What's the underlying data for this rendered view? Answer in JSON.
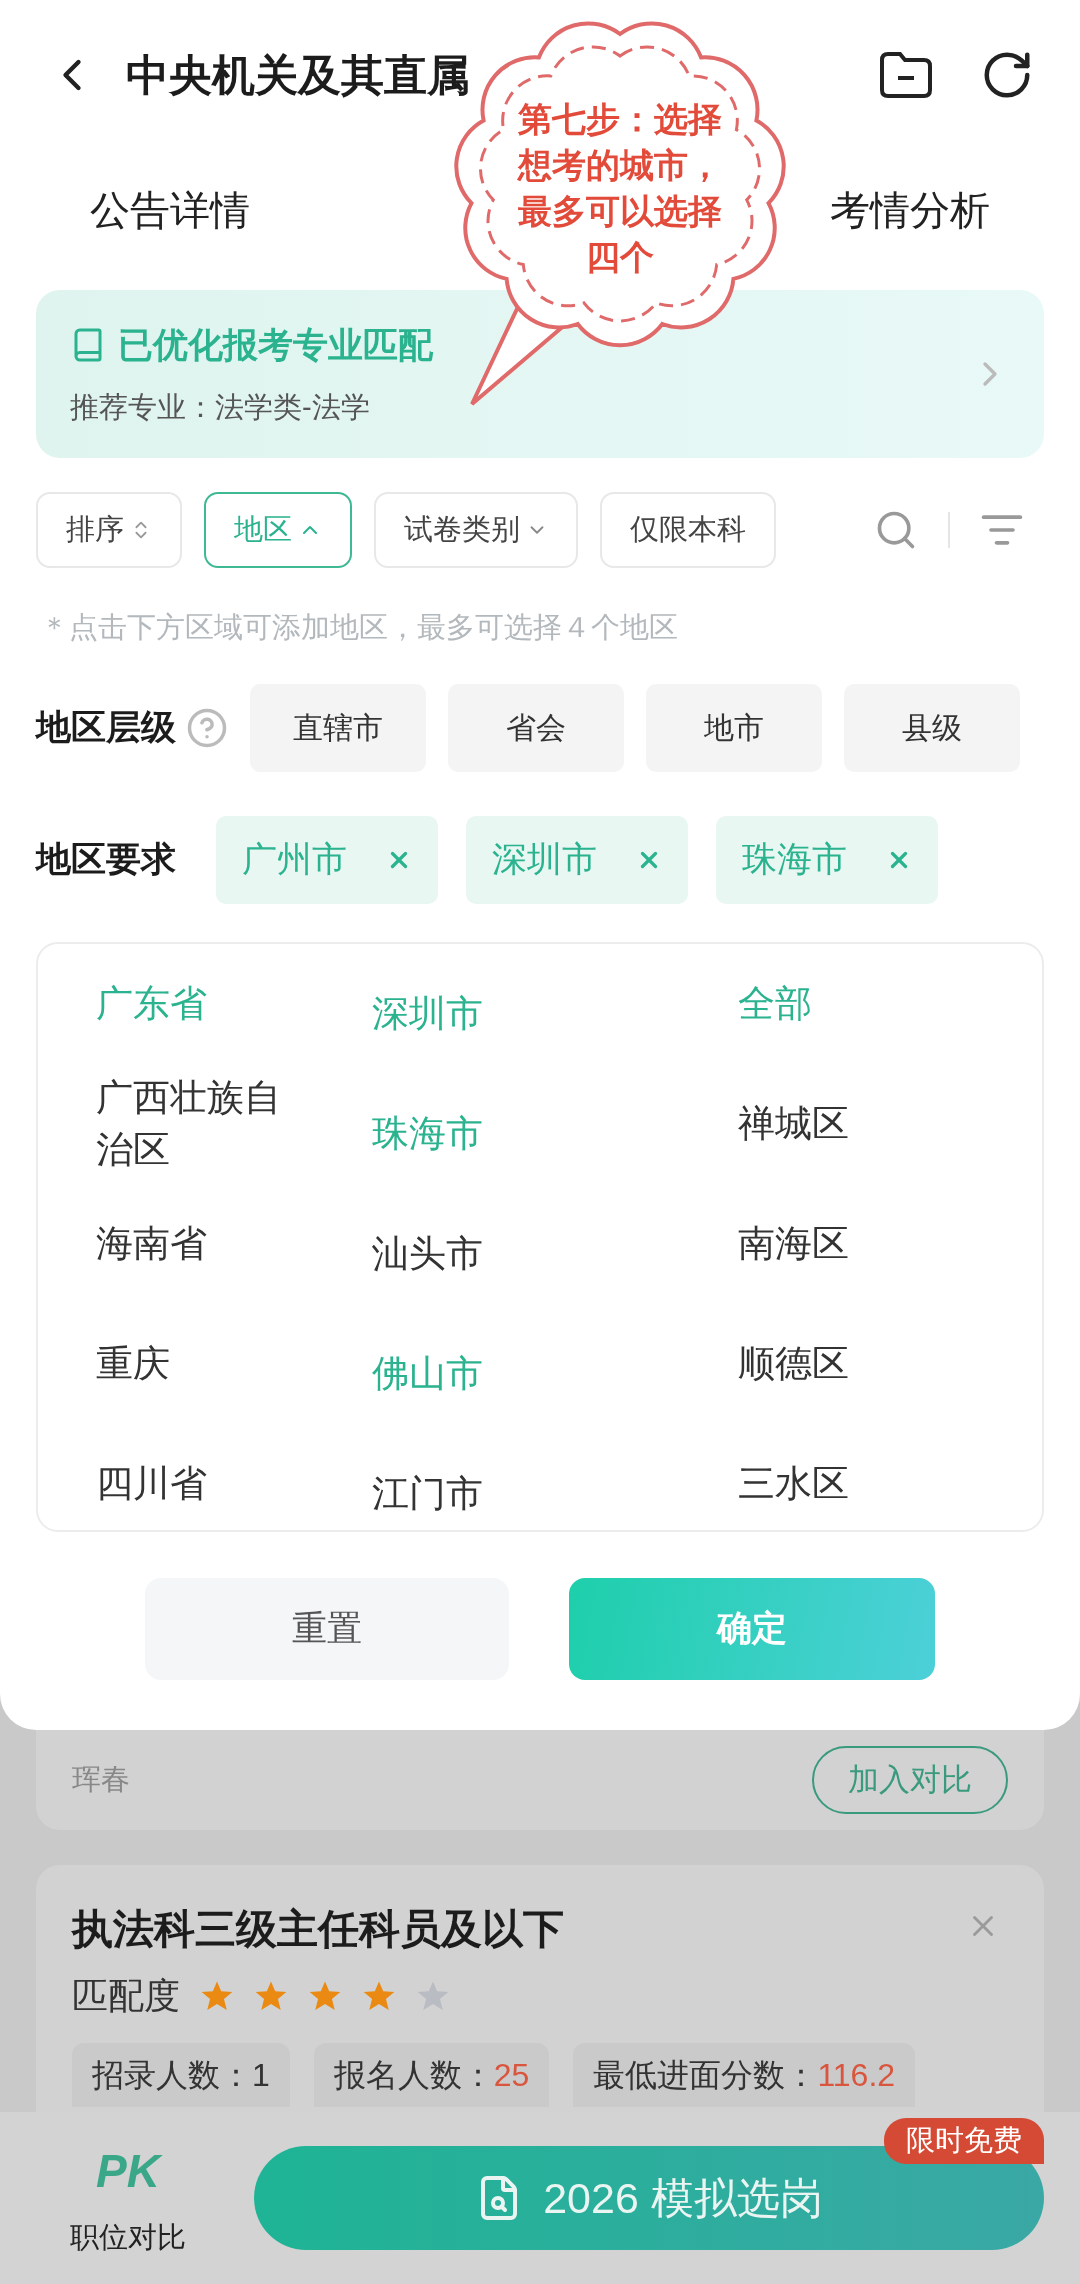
{
  "header": {
    "title": "中央机关及其直属"
  },
  "tabs": [
    {
      "label": "公告详情"
    },
    {
      "label": "考情分析"
    }
  ],
  "banner": {
    "title": "已优化报考专业匹配",
    "subtitle": "推荐专业：法学类-法学"
  },
  "filters": [
    {
      "label": "排序",
      "kind": "sort",
      "selected": false
    },
    {
      "label": "地区",
      "kind": "dropdown",
      "selected": true
    },
    {
      "label": "试卷类别",
      "kind": "dropdown",
      "selected": false
    },
    {
      "label": "仅限本科",
      "kind": "plain",
      "selected": false
    }
  ],
  "hint": "＊点击下方区域可添加地区，最多可选择４个地区",
  "level_row": {
    "label": "地区层级",
    "options": [
      "直辖市",
      "省会",
      "地市",
      "县级"
    ]
  },
  "region_row": {
    "label": "地区要求",
    "chips": [
      "广州市",
      "深圳市",
      "珠海市"
    ]
  },
  "provinces": [
    {
      "name": "广东省",
      "selected": true
    },
    {
      "name": "广西壮族自治区",
      "selected": false
    },
    {
      "name": "海南省",
      "selected": false
    },
    {
      "name": "重庆",
      "selected": false
    },
    {
      "name": "四川省",
      "selected": false
    }
  ],
  "cities": [
    {
      "name": "深圳市",
      "selected": true
    },
    {
      "name": "珠海市",
      "selected": true
    },
    {
      "name": "汕头市",
      "selected": false
    },
    {
      "name": "佛山市",
      "selected": true
    },
    {
      "name": "江门市",
      "selected": false
    }
  ],
  "districts": [
    {
      "name": "全部",
      "selected": true
    },
    {
      "name": "禅城区",
      "selected": false
    },
    {
      "name": "南海区",
      "selected": false
    },
    {
      "name": "顺德区",
      "selected": false
    },
    {
      "name": "三水区",
      "selected": false
    }
  ],
  "buttons": {
    "reset": "重置",
    "confirm": "确定"
  },
  "card_fragment": {
    "location": "珲春",
    "compare": "加入对比"
  },
  "job_card": {
    "title": "执法科三级主任科员及以下",
    "match_label": "匹配度",
    "stars": 4,
    "stats": [
      {
        "label": "招录人数：",
        "value": "1",
        "highlight": false
      },
      {
        "label": "报名人数：",
        "value": "25",
        "highlight": true
      },
      {
        "label": "最低进面分数：",
        "value": "116.2",
        "highlight": true
      }
    ]
  },
  "bottom_bar": {
    "logo": "PK",
    "compare_label": "职位对比",
    "main_button": "2026 模拟选岗",
    "badge": "限时免费"
  },
  "callout": {
    "text": "第七步：选择想考的城市，最多可以选择四个"
  }
}
